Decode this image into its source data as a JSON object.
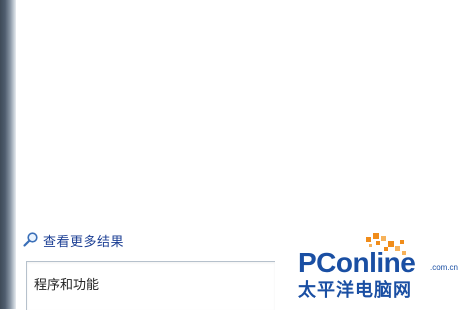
{
  "results": {
    "see_more_label": "查看更多结果",
    "see_more_icon": "magnifier-icon"
  },
  "search": {
    "value": "程序和功能"
  },
  "watermark": {
    "brand": "PConline",
    "domain": ".com.cn",
    "chinese_name": "太平洋电脑网",
    "colors": {
      "blue": "#1a4fa3",
      "orange": "#f08c1a"
    }
  }
}
